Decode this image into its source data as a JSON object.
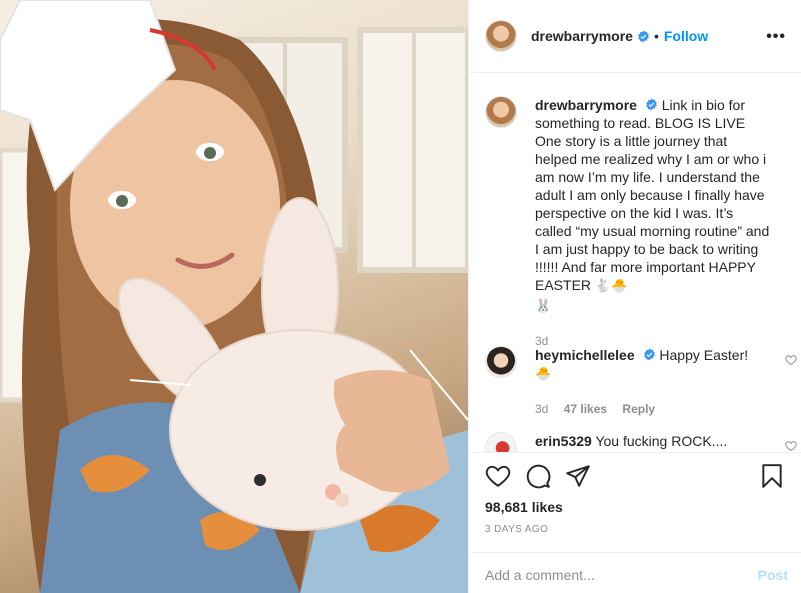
{
  "header": {
    "username": "drewbarrymore",
    "separator": "•",
    "follow_label": "Follow",
    "more_label": "•••",
    "avatar_icon": "profile-avatar",
    "verified_icon": "verified-badge-icon",
    "verified_color": "#3897f0"
  },
  "caption": {
    "username": "drewbarrymore",
    "text": "Link in bio for something to read. BLOG IS LIVE One story is a little journey that helped me realized why I am or who i am now I’m my life. I understand the adult I am only because I finally have perspective on the kid I was. It’s called “my usual morning routine” and I am just happy to be back to writing !!!!!! And far more important HAPPY EASTER",
    "emoji_line1": "🐇🐣",
    "emoji_line2": "🐰",
    "age": "3d"
  },
  "comments": [
    {
      "username": "heymichellelee",
      "text": "Happy Easter!",
      "emoji": "🐣",
      "age": "3d",
      "likes": "47 likes",
      "reply": "Reply"
    },
    {
      "username": "erin5329",
      "text": "You fucking ROCK...."
    }
  ],
  "actions": {
    "like_icon": "heart-icon",
    "comment_icon": "comment-icon",
    "share_icon": "share-icon",
    "save_icon": "bookmark-icon",
    "likes": "98,681 likes",
    "posted": "3 DAYS AGO"
  },
  "add_comment": {
    "placeholder": "Add a comment...",
    "post_label": "Post",
    "post_color": "#b2dffc"
  },
  "colors": {
    "accent": "#0095f6",
    "text": "#262626",
    "muted": "#8e8e8e",
    "border": "#efefef"
  }
}
